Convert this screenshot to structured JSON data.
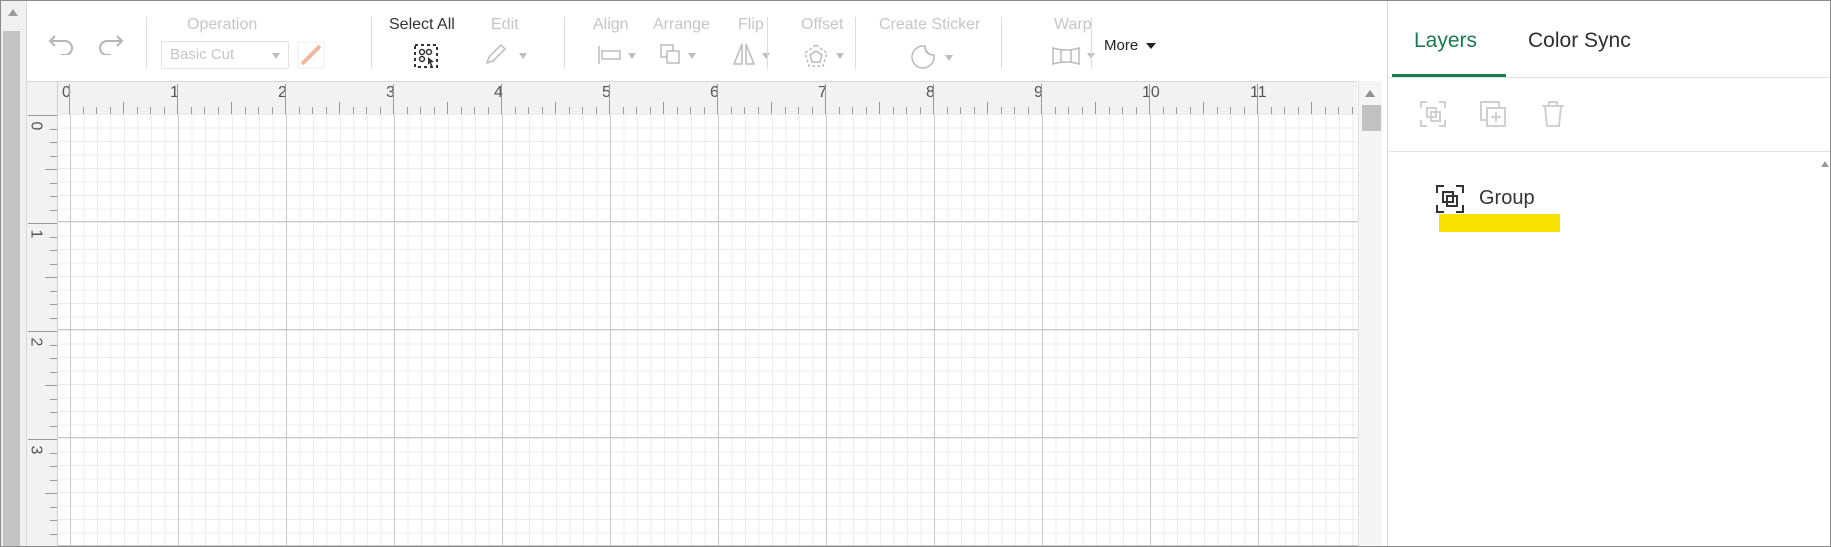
{
  "toolbar": {
    "operation_label": "Operation",
    "operation_value": "Basic Cut",
    "select_all_label": "Select All",
    "edit_label": "Edit",
    "align_label": "Align",
    "arrange_label": "Arrange",
    "flip_label": "Flip",
    "offset_label": "Offset",
    "create_sticker_label": "Create Sticker",
    "warp_label": "Warp",
    "more_label": "More"
  },
  "ruler": {
    "top_numbers": [
      "0",
      "1",
      "2",
      "3",
      "4",
      "5",
      "6",
      "7",
      "8",
      "9",
      "10",
      "11"
    ],
    "left_numbers": [
      "0",
      "1",
      "2",
      "3"
    ]
  },
  "panel": {
    "tabs": [
      {
        "label": "Layers",
        "active": true
      },
      {
        "label": "Color Sync",
        "active": false
      }
    ],
    "accent_color": "#1c7a4f",
    "layer": {
      "label": "Group",
      "icon": "group-icon",
      "highlight_color": "#f8e300"
    }
  }
}
